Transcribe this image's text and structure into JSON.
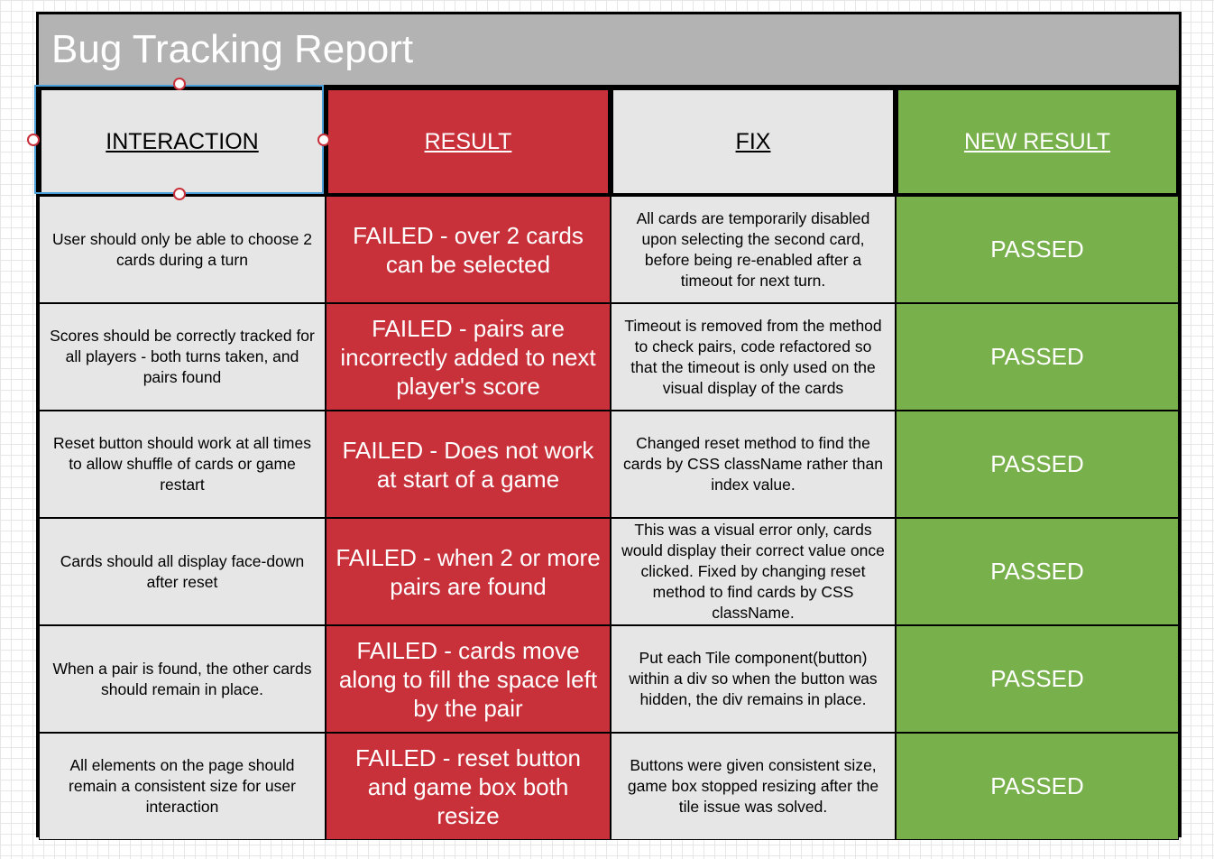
{
  "title": "Bug Tracking Report",
  "headers": {
    "interaction": "INTERACTION",
    "result": "RESULT",
    "fix": "FIX",
    "new_result": "NEW RESULT"
  },
  "colors": {
    "title_bg": "#b3b3b3",
    "cell_grey": "#e6e6e6",
    "failed_red": "#c8303a",
    "passed_green": "#78b04b",
    "selection_blue": "#4a9fd8"
  },
  "rows": [
    {
      "interaction": "User should only be able to choose 2 cards during a turn",
      "result": "FAILED - over 2 cards can be selected",
      "fix": "All cards are temporarily disabled upon selecting the second card, before being re-enabled after a timeout for next turn.",
      "new_result": "PASSED"
    },
    {
      "interaction": "Scores should be correctly tracked for all players - both turns taken, and pairs found",
      "result": "FAILED - pairs are incorrectly added to next player's score",
      "fix": "Timeout  is removed from the method to check pairs, code refactored so that the timeout is only used on the visual display of the cards",
      "new_result": "PASSED"
    },
    {
      "interaction": "Reset button should work at all times to allow shuffle of cards or game restart",
      "result": "FAILED - Does not work at start of a game",
      "fix": "Changed reset method to find the cards by CSS className rather than index value.",
      "new_result": "PASSED"
    },
    {
      "interaction": "Cards should all display face-down after reset",
      "result": "FAILED - when 2 or more pairs are found",
      "fix": "This was a visual error only, cards would display their correct value once clicked. Fixed by changing reset method to find cards by CSS className.",
      "new_result": "PASSED"
    },
    {
      "interaction": "When a pair is found, the other cards should remain in place.",
      "result": "FAILED - cards move along to fill the space left by the pair",
      "fix": "Put each Tile component(button) within a div so when the button was hidden, the div remains in place.",
      "new_result": "PASSED"
    },
    {
      "interaction": "All elements on the page should remain a consistent size for user interaction",
      "result": "FAILED - reset button and game box both resize",
      "fix": "Buttons were given consistent size, game box stopped resizing after the tile issue was solved.",
      "new_result": "PASSED"
    }
  ]
}
